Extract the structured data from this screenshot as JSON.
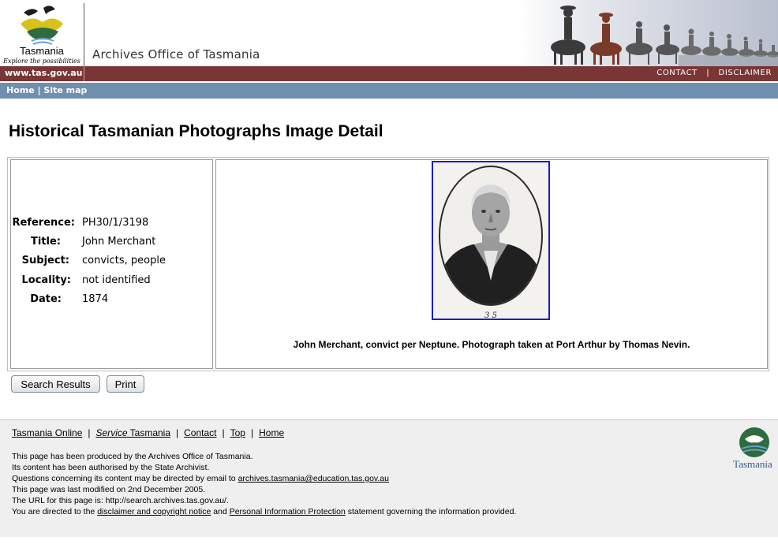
{
  "header": {
    "logo_text": "Tasmania",
    "logo_tagline": "Explore the possibilities",
    "site_title": "Archives Office of Tasmania",
    "url_label": "www.tas.gov.au",
    "top_links": {
      "contact": "CONTACT",
      "separator": "|",
      "disclaimer": "DISCLAIMER"
    }
  },
  "breadcrumb": {
    "home": "Home",
    "separator": "|",
    "sitemap": "Site map"
  },
  "page_title": "Historical Tasmanian Photographs Image Detail",
  "record": {
    "fields": [
      {
        "label": "Reference:",
        "value": "PH30/1/3198"
      },
      {
        "label": "Title:",
        "value": "John Merchant"
      },
      {
        "label": "Subject:",
        "value": "convicts, people"
      },
      {
        "label": "Locality:",
        "value": "not identified"
      },
      {
        "label": "Date:",
        "value": "1874"
      }
    ],
    "photo_inscription": "3 5",
    "caption": "John Merchant, convict per Neptune. Photograph taken at Port Arthur by Thomas Nevin."
  },
  "buttons": {
    "search_results": "Search Results",
    "print": "Print"
  },
  "footer": {
    "links": {
      "tasmania_online": "Tasmania Online",
      "service_italic": "Service",
      "service_rest": " Tasmania",
      "contact": "Contact",
      "top": "Top",
      "home": "Home",
      "pipe": "|"
    },
    "lines": {
      "produced": "This page has been produced by the Archives Office of Tasmania.",
      "authorised": "Its content has been authorised by the State Archivist.",
      "questions_prefix": "Questions concerning its content may be directed by email to ",
      "email": "archives.tasmania@education.tas.gov.au",
      "modified": "This page was last modified on 2nd December 2005.",
      "url_line": "The URL for this page is: http://search.archives.tas.gov.au/.",
      "directed_prefix": "You are directed to the ",
      "disclaimer_link": "disclaimer and copyright notice",
      "and": " and ",
      "pip_link": "Personal Information Protection",
      "directed_suffix": " statement governing the information provided."
    },
    "logo_text": "Tasmania"
  },
  "colors": {
    "header_red": "#7a3535",
    "nav_blue": "#6f8fae",
    "photo_border": "#1c1cc8",
    "footer_bg": "#efefef",
    "logo_green": "#2e6b3e",
    "logo_yellow": "#d7c21a"
  }
}
